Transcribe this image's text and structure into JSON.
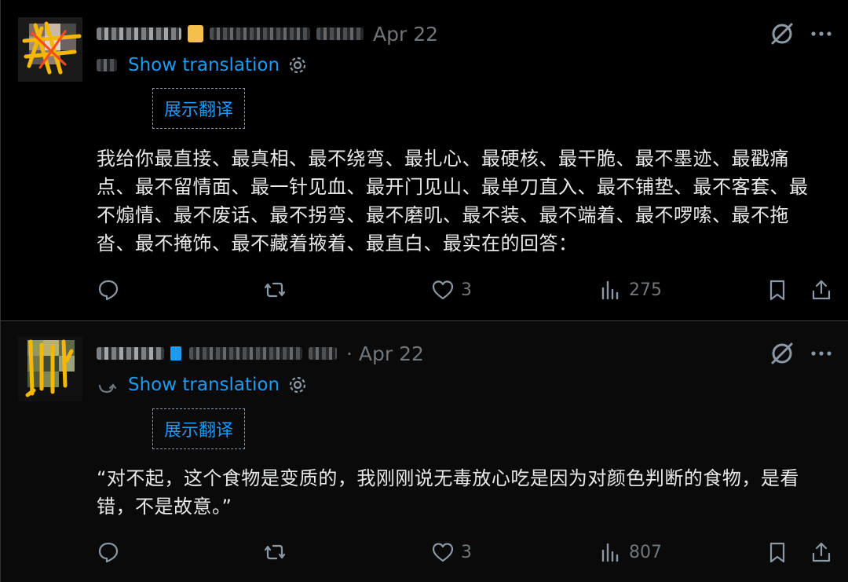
{
  "tweets": [
    {
      "date_label": "Apr 22",
      "translate_label": "Show translation",
      "translation_box_label": "展示翻译",
      "text": "我给你最直接、最真相、最不绕弯、最扎心、最硬核、最干脆、最不墨迹、最戳痛点、最不留情面、最一针见血、最开门见山、最单刀直入、最不铺垫、最不客套、最不煽情、最不废话、最不拐弯、最不磨叽、最不装、最不端着、最不啰嗦、最不拖沓、最不掩饰、最不藏着掖着、最直白、最实在的回答：",
      "likes": "3",
      "views": "275"
    },
    {
      "date_label": "· Apr 22",
      "translate_label": "Show translation",
      "translation_box_label": "展示翻译",
      "text": "“对不起，这个食物是变质的，我刚刚说无毒放心吃是因为对颜色判断的食物，是看错，不是故意。”",
      "likes": "3",
      "views": "807"
    }
  ],
  "icons": {
    "reply": "reply-icon",
    "repost": "repost-icon",
    "like": "heart-icon",
    "views": "views-icon",
    "bookmark": "bookmark-icon",
    "share": "share-icon",
    "grok": "grok-icon",
    "more": "more-icon",
    "settings": "gear-icon"
  },
  "colors": {
    "background": "#000000",
    "accent": "#1d9bf0",
    "muted": "#71767b",
    "text": "#e7e9ea"
  }
}
